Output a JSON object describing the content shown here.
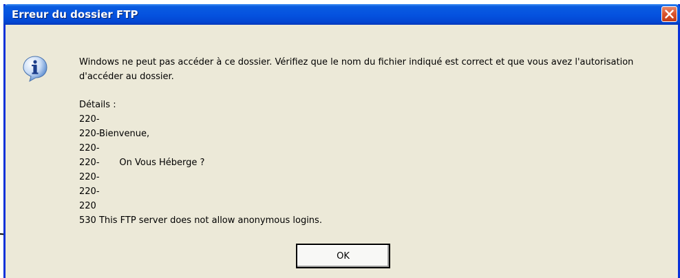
{
  "dialog": {
    "title": "Erreur du dossier FTP",
    "message": "Windows ne peut pas accéder à ce dossier. Vérifiez que le nom du fichier indiqué est correct et que vous avez l'autorisation d'accéder au dossier.",
    "details_lines": [
      "Détails :",
      "220-",
      "220-Bienvenue,",
      "220-",
      "220-       On Vous Héberge ?",
      "220-",
      "220-",
      "220",
      "530 This FTP server does not allow anonymous logins."
    ],
    "ok_label": "OK",
    "close_icon": "close-icon",
    "info_icon": "info-icon"
  },
  "colors": {
    "title_bar": "#0553e0",
    "close_button": "#d9532c",
    "dialog_bg": "#ece9d8",
    "frame": "#0831d9"
  }
}
